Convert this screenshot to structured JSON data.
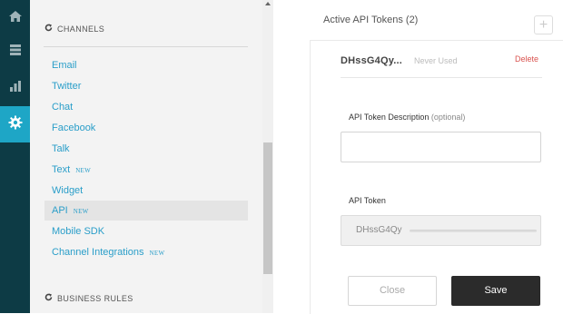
{
  "sidebar": {
    "channels_heading": "CHANNELS",
    "business_rules_heading": "BUSINESS RULES",
    "items": [
      {
        "label": "Email",
        "badge": ""
      },
      {
        "label": "Twitter",
        "badge": ""
      },
      {
        "label": "Chat",
        "badge": ""
      },
      {
        "label": "Facebook",
        "badge": ""
      },
      {
        "label": "Talk",
        "badge": ""
      },
      {
        "label": "Text",
        "badge": "NEW"
      },
      {
        "label": "Widget",
        "badge": ""
      },
      {
        "label": "API",
        "badge": "NEW"
      },
      {
        "label": "Mobile SDK",
        "badge": ""
      },
      {
        "label": "Channel Integrations",
        "badge": "NEW"
      }
    ],
    "active_item": "API"
  },
  "main": {
    "tokens_title": "Active API Tokens (2)",
    "add_label": "+",
    "token": {
      "name": "DHssG4Qy...",
      "status": "Never Used",
      "delete_label": "Delete"
    },
    "description_label": "API Token Description",
    "description_optional": "(optional)",
    "description_value": "",
    "token_label": "API Token",
    "token_value": "DHssG4Qy",
    "close_label": "Close",
    "save_label": "Save"
  },
  "colors": {
    "rail": "#0d3b45",
    "rail_active": "#1ea6c6",
    "link": "#2a9ec9",
    "delete": "#d9534f",
    "save_button": "#2b2b2b"
  },
  "icons": [
    "home-icon",
    "inbox-icon",
    "bar-chart-icon",
    "gear-icon",
    "refresh-icon"
  ]
}
